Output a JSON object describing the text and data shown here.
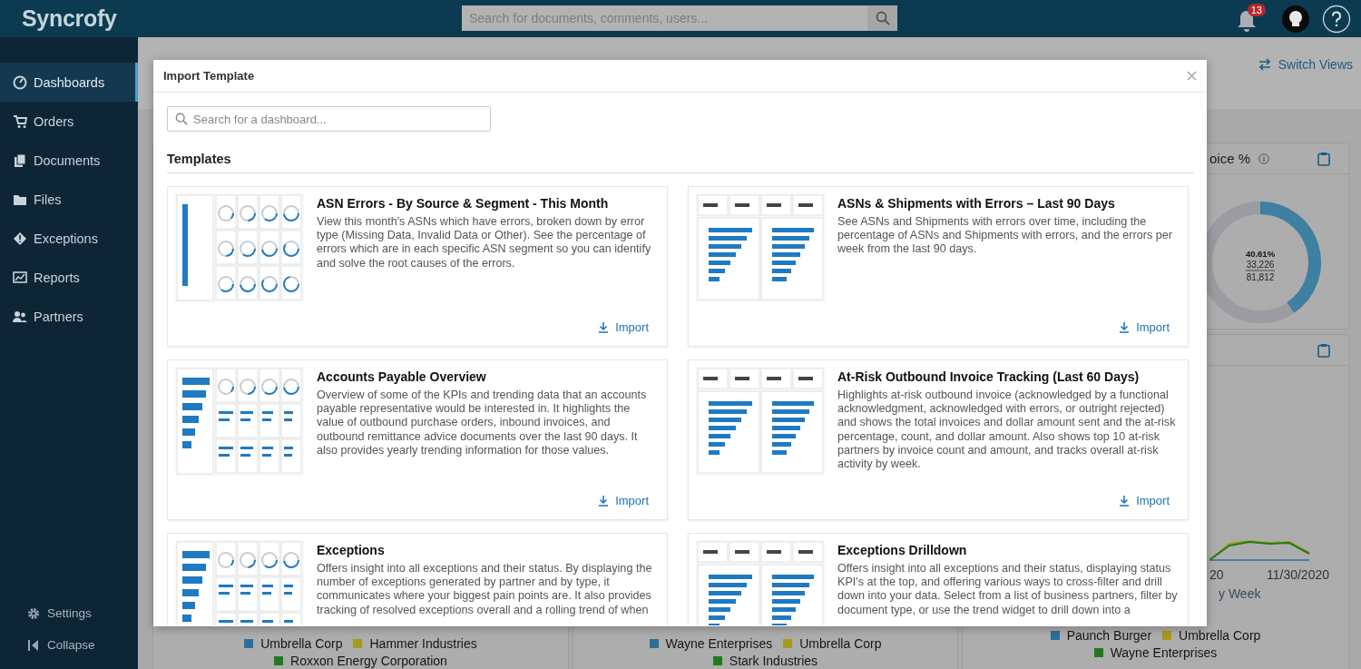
{
  "topbar": {
    "logo": "Syncrofy",
    "search": {
      "placeholder": "Search for documents, comments, users..."
    },
    "notifications": {
      "count": "13"
    }
  },
  "sidebar": {
    "items": [
      {
        "label": "Dashboards",
        "selected": true
      },
      {
        "label": "Orders",
        "selected": false
      },
      {
        "label": "Documents",
        "selected": false
      },
      {
        "label": "Files",
        "selected": false
      },
      {
        "label": "Exceptions",
        "selected": false
      },
      {
        "label": "Reports",
        "selected": false
      },
      {
        "label": "Partners",
        "selected": false
      }
    ],
    "footer": [
      {
        "label": "Settings"
      },
      {
        "label": "Collapse"
      }
    ]
  },
  "dashboard": {
    "switch_views": "Switch Views",
    "gauge_panel": {
      "title": "oice %",
      "gauge": {
        "percent": "40.61%",
        "numerator": "33,226",
        "denominator": "81,812"
      }
    },
    "trend_panel": {
      "x_labels": [
        "20",
        "11/30/2020"
      ],
      "axis_title": "y Week"
    },
    "legends": [
      [
        {
          "label": "Umbrella Corp",
          "color": "#2a6f9b"
        },
        {
          "label": "Hammer Industries",
          "color": "#a89a1e"
        },
        {
          "label": "Roxxon Energy Corporation",
          "color": "#217a1f"
        }
      ],
      [
        {
          "label": "Wayne Enterprises",
          "color": "#2a6f9b"
        },
        {
          "label": "Umbrella Corp",
          "color": "#a89a1e"
        },
        {
          "label": "Stark Industries",
          "color": "#217a1f"
        }
      ],
      [
        {
          "label": "Paunch Burger",
          "color": "#2a6f9b"
        },
        {
          "label": "Umbrella Corp",
          "color": "#a89a1e"
        },
        {
          "label": "Wayne Enterprises",
          "color": "#217a1f"
        }
      ]
    ]
  },
  "modal": {
    "title": "Import Template",
    "search": {
      "placeholder": "Search for a dashboard..."
    },
    "section": "Templates",
    "templates": [
      {
        "title": "ASN Errors - By Source & Segment - This Month",
        "description": "View this month's ASNs which have errors, broken down by error type (Missing Data, Invalid Data or Other). See the percentage of errors which are in each specific ASN segment so you can identify and solve the root causes of the errors.",
        "action": "Import"
      },
      {
        "title": "ASNs & Shipments with Errors – Last 90 Days",
        "description": "See ASNs and Shipments with errors over time, including the percentage of ASNs and Shipments with errors, and the errors per week from the last 90 days.",
        "action": "Import"
      },
      {
        "title": "Accounts Payable Overview",
        "description": "Overview of some of the KPIs and trending data that an accounts payable representative would be interested in. It highlights the value of outbound purchase orders, inbound invoices, and outbound remittance advice documents over the last 90 days. It also provides yearly trending information for those values.",
        "action": "Import"
      },
      {
        "title": "At-Risk Outbound Invoice Tracking (Last 60 Days)",
        "description": "Highlights at-risk outbound invoice (acknowledged by a functional acknowledgment, acknowledged with errors, or outright rejected) and shows the total invoices and dollar amount sent and the at-risk percentage, count, and dollar amount. Also shows top 10 at-risk partners by invoice count and amount, and tracks overall at-risk activity by week.",
        "action": "Import"
      },
      {
        "title": "Exceptions",
        "description": "Offers insight into all exceptions and their status. By displaying the number of exceptions generated by partner and by type, it communicates where your biggest pain points are. It also provides tracking of resolved exceptions overall and a rolling trend of when"
      },
      {
        "title": "Exceptions Drilldown",
        "description": "Offers insight into all exceptions and their status, displaying status KPI's at the top, and offering various ways to cross-filter and drill down into your data. Select from a list of business partners, filter by document type, or use the trend widget to drill down into a"
      }
    ]
  }
}
